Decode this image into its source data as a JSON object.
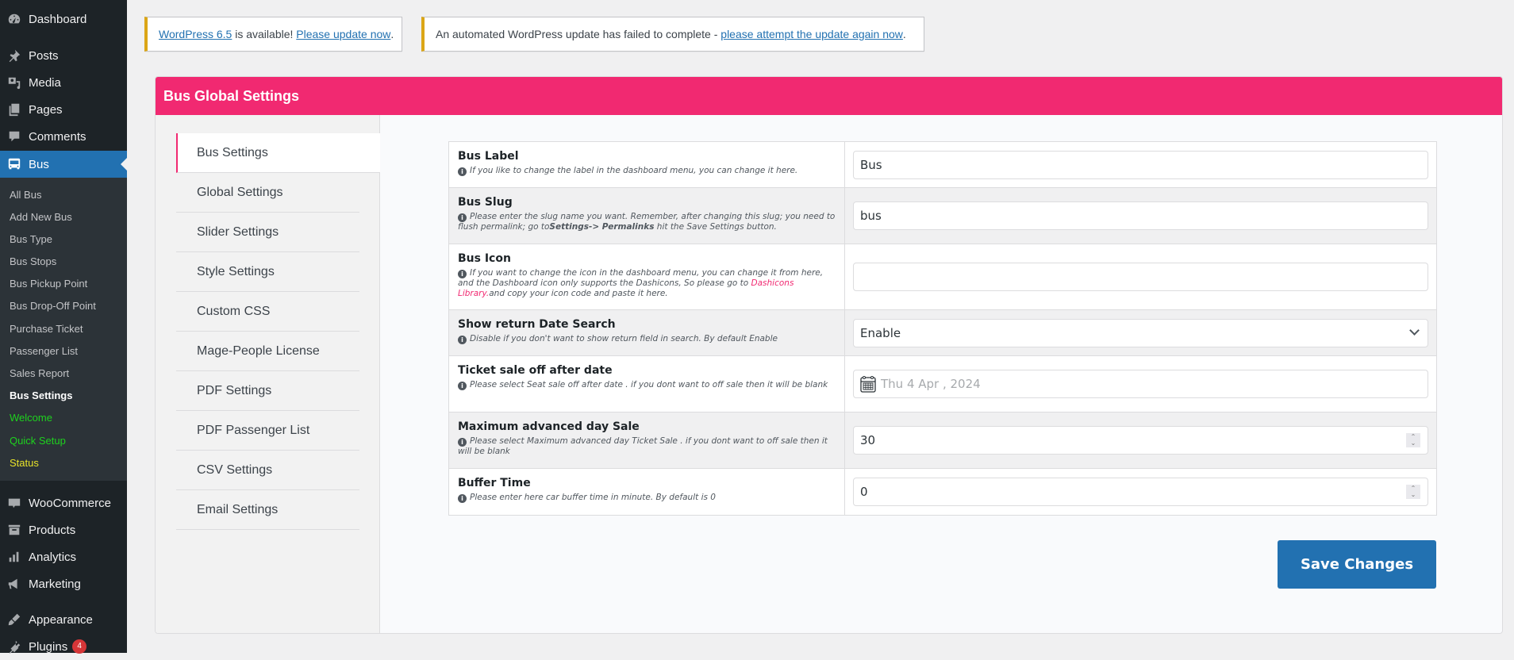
{
  "sidebar": {
    "items": [
      {
        "label": "Dashboard",
        "icon": "dashboard-icon"
      },
      {
        "label": "Posts",
        "icon": "pin-icon"
      },
      {
        "label": "Media",
        "icon": "media-icon"
      },
      {
        "label": "Pages",
        "icon": "pages-icon"
      },
      {
        "label": "Comments",
        "icon": "comment-icon"
      },
      {
        "label": "Bus",
        "icon": "bus-icon",
        "active": true
      },
      {
        "label": "WooCommerce",
        "icon": "woo-icon"
      },
      {
        "label": "Products",
        "icon": "archive-icon"
      },
      {
        "label": "Analytics",
        "icon": "bar-chart-icon"
      },
      {
        "label": "Marketing",
        "icon": "megaphone-icon"
      },
      {
        "label": "Appearance",
        "icon": "brush-icon"
      },
      {
        "label": "Plugins",
        "icon": "plugin-icon",
        "badge": "4"
      }
    ],
    "submenu": [
      {
        "label": "All Bus"
      },
      {
        "label": "Add New Bus"
      },
      {
        "label": "Bus Type"
      },
      {
        "label": "Bus Stops"
      },
      {
        "label": "Bus Pickup Point"
      },
      {
        "label": "Bus Drop-Off Point"
      },
      {
        "label": "Purchase Ticket"
      },
      {
        "label": "Passenger List"
      },
      {
        "label": "Sales Report"
      },
      {
        "label": "Bus Settings",
        "current": true
      },
      {
        "label": "Welcome",
        "color": "#1ed21e"
      },
      {
        "label": "Quick Setup",
        "color": "#1ed21e"
      },
      {
        "label": "Status",
        "color": "#e8e32a"
      }
    ]
  },
  "notices": {
    "update": {
      "link1": "WordPress 6.5",
      "middle": " is available! ",
      "link2": "Please update now",
      "end": "."
    },
    "failed": {
      "text": "An automated WordPress update has failed to complete - ",
      "link": "please attempt the update again now",
      "end": "."
    }
  },
  "panel": {
    "title": "Bus Global Settings",
    "accent_color": "#f12971",
    "tabs": [
      {
        "label": "Bus Settings",
        "active": true
      },
      {
        "label": "Global Settings"
      },
      {
        "label": "Slider Settings"
      },
      {
        "label": "Style Settings"
      },
      {
        "label": "Custom CSS"
      },
      {
        "label": "Mage-People License"
      },
      {
        "label": "PDF Settings"
      },
      {
        "label": "PDF Passenger List"
      },
      {
        "label": "CSV Settings"
      },
      {
        "label": "Email Settings"
      }
    ]
  },
  "form": {
    "bus_label": {
      "title": "Bus Label",
      "desc": "If you like to change the label in the dashboard menu, you can change it here.",
      "value": "Bus"
    },
    "bus_slug": {
      "title": "Bus Slug",
      "desc_a": "Please enter the slug name you want. Remember, after changing this slug; you need to flush permalink; go to",
      "desc_bold": "Settings-> Permalinks",
      "desc_b": " hit the Save Settings button.",
      "value": "bus"
    },
    "bus_icon": {
      "title": "Bus Icon",
      "desc_a": "If you want to change the icon in the dashboard menu, you can change it from here, and the Dashboard icon only supports the Dashicons, So please go to ",
      "desc_link": "Dashicons Library.",
      "desc_b": "and copy your icon code and paste it here.",
      "value": ""
    },
    "return_date": {
      "title": "Show return Date Search",
      "desc": "Disable if you don't want to show return field in search. By default Enable",
      "value": "Enable"
    },
    "ticket_sale_off": {
      "title": "Ticket sale off after date",
      "desc": "Please select Seat sale off after date . if you dont want to off sale then it will be blank",
      "placeholder": "Thu 4 Apr , 2024"
    },
    "max_advanced": {
      "title": "Maximum advanced day Sale",
      "desc": "Please select Maximum advanced day Ticket Sale . if you dont want to off sale then it will be blank",
      "value": "30"
    },
    "buffer_time": {
      "title": "Buffer Time",
      "desc": "Please enter here car buffer time in minute. By default is 0",
      "value": "0"
    }
  },
  "actions": {
    "save_label": "Save Changes"
  }
}
